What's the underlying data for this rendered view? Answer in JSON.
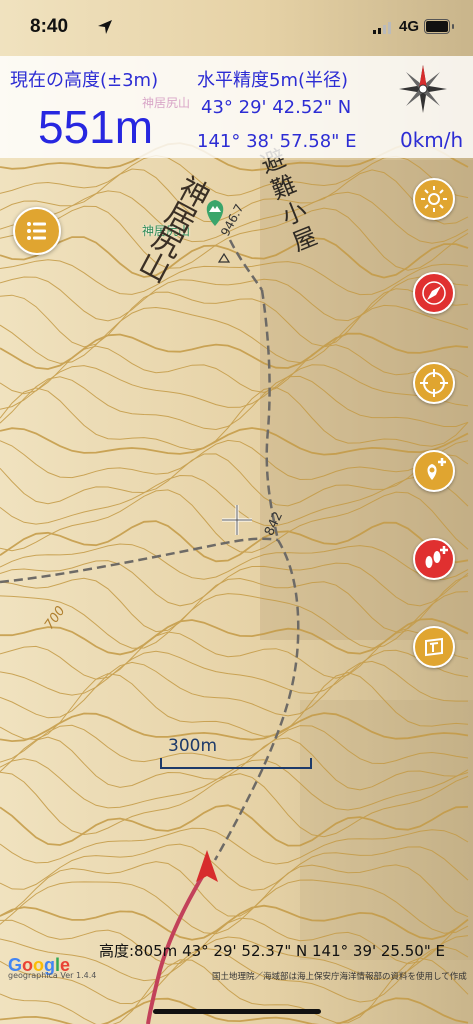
{
  "status_bar": {
    "time": "8:40",
    "network": "4G",
    "icons": [
      "location-arrow-icon",
      "signal-bars-icon",
      "battery-icon"
    ]
  },
  "info_panel": {
    "altitude_label": "現在の高度(±3m)",
    "altitude_value": "551m",
    "accuracy_label": "水平精度5m(半径)",
    "latitude": "43° 29' 42.52\" N",
    "longitude": "141° 38' 57.58\" E",
    "speed": "0km/h",
    "compass_icon": "compass-rose-icon"
  },
  "map": {
    "peak_name": "神居尻山",
    "peak_name_faded": "神居尻山",
    "elevation_point": "946.7",
    "elevation_spot": "842",
    "contour_label": "700",
    "vertical_label_mountain": "神居尻山",
    "vertical_label_hut": "避難小屋",
    "scale_label": "300m",
    "colors": {
      "terrain": "#e9d9b4",
      "contour": "#c49a45",
      "trail": "#6d6a66",
      "track": "#c2415a",
      "position_marker": "#d72c2c"
    }
  },
  "toolbar": {
    "menu_icon": "list-menu-icon",
    "buttons": [
      "sun-spiral-icon",
      "compass-needle-icon",
      "crosshair-icon",
      "add-waypoint-icon",
      "add-footprint-icon",
      "map-layer-icon"
    ]
  },
  "footer": {
    "cursor_info": "高度:805m  43° 29' 52.37\" N 141° 39' 25.50\" E",
    "google_logo": "Google",
    "version": "geographica Ver 1.4.4",
    "attribution": "国土地理院／海域部は海上保安庁海洋情報部の資料を使用して作成"
  }
}
